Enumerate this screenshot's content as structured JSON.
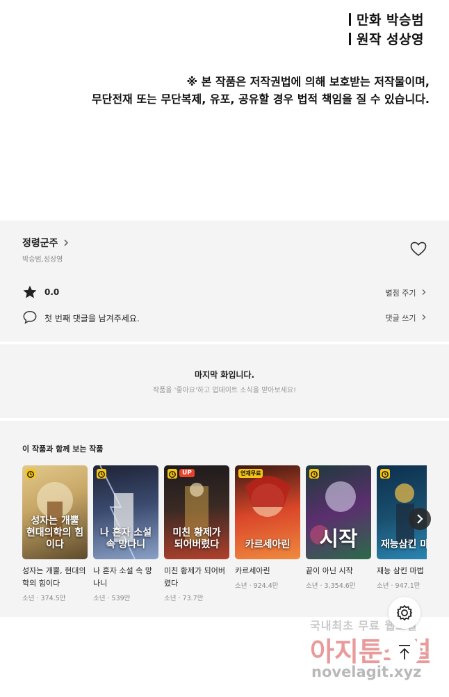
{
  "credits": {
    "comic": "만화 박승범",
    "original": "원작 성상영"
  },
  "notice": {
    "line1": "※ 본 작품은 저작권법에 의해 보호받는 저작물이며,",
    "line2": "무단전재 또는 무단복제, 유포, 공유할 경우 법적 책임을 질 수 있습니다."
  },
  "work": {
    "title": "정령군주",
    "authors": "박승범,성상영",
    "rating": "0.0",
    "rate_action": "별점 주기",
    "comment_prompt": "첫 번째 댓글을 남겨주세요.",
    "comment_action": "댓글 쓰기"
  },
  "last_episode": {
    "title": "마지막 화입니다.",
    "subtitle": "작품을 '좋아요'하고 업데이트 소식을 받아보세요!"
  },
  "recommend": {
    "heading": "이 작품과 함께 보는 작품",
    "items": [
      {
        "title": "성자는 개뿔, 현대의학의 힘이다",
        "meta": "소년 · 374.5만",
        "badge": "clock",
        "cover": "성자는 개뿔 현대의학의 힘이다",
        "color1": "#c8a766",
        "color2": "#5d4a2c"
      },
      {
        "title": "나 혼자 소설 속 망나니",
        "meta": "소년 · 539만",
        "badge": "clock",
        "cover": "나 혼자 소설 속 망나니",
        "color1": "#2a2f45",
        "color2": "#8aa0c6"
      },
      {
        "title": "미친 황제가 되어버렸다",
        "meta": "소년 · 73.7만",
        "badge": "UP",
        "cover": "미친 황제가 되어버렸다",
        "color1": "#1d1a1c",
        "color2": "#b0402c"
      },
      {
        "title": "카르세아린",
        "meta": "소년 · 924.4만",
        "badge": "연재무료",
        "cover": "카르세아린",
        "color1": "#d9462a",
        "color2": "#3c1a12"
      },
      {
        "title": "끝이 아닌 시작",
        "meta": "소년 · 3,354.6만",
        "badge": "clock",
        "cover": "시작",
        "color1": "#5b2f6e",
        "color2": "#1c3b3a"
      },
      {
        "title": "재능 삼킨 마법",
        "meta": "소년 · 947.1만",
        "badge": "clock",
        "cover": "재능삼킨 마법",
        "color1": "#0d2f4e",
        "color2": "#2a8ab8"
      }
    ]
  },
  "watermark": {
    "line1": "국내최초 무료 웹소설",
    "line2": "아지툰소설",
    "line3": "novelagit.xyz"
  }
}
